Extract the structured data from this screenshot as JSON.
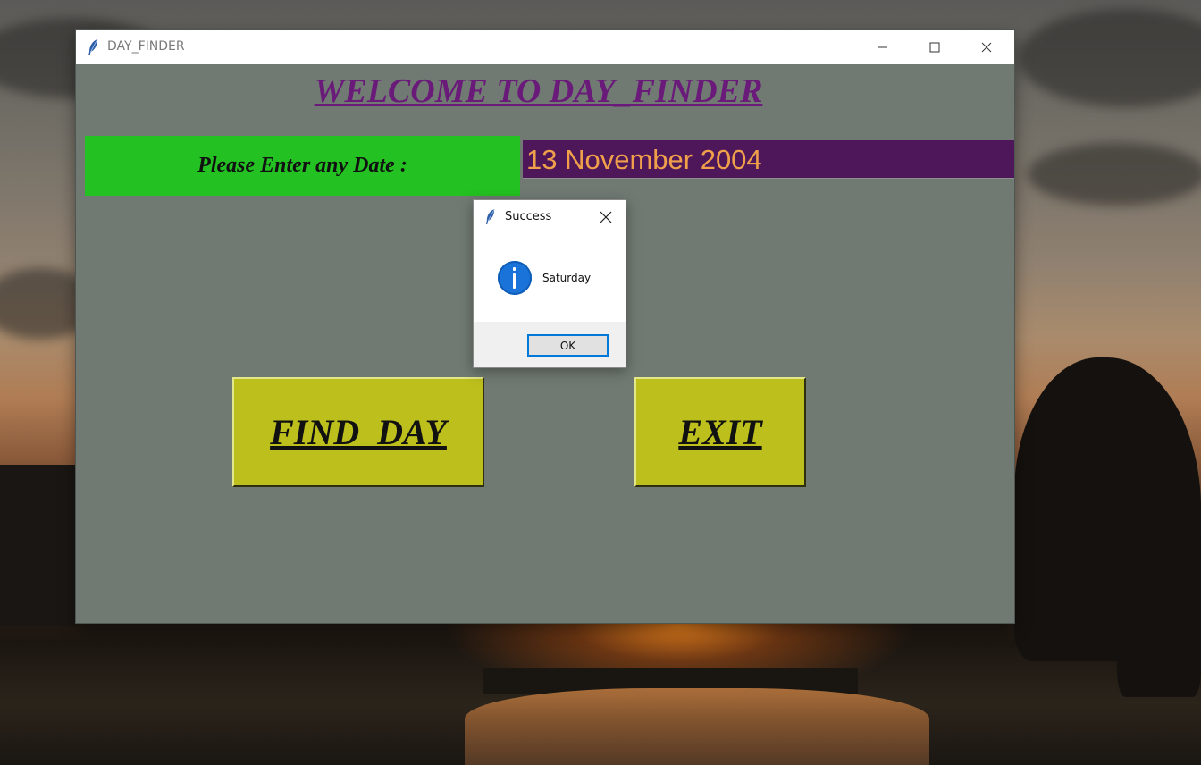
{
  "window": {
    "title": "DAY_FINDER",
    "icon": "feather-icon",
    "controls": [
      "minimize-icon",
      "maximize-icon",
      "close-icon"
    ],
    "background_color": "#707a72"
  },
  "main": {
    "heading": "WELCOME TO DAY_FINDER",
    "prompt_label": "Please Enter any Date :",
    "date_input_value": "13 November 2004",
    "find_button_label": "FIND_DAY",
    "exit_button_label": "EXIT"
  },
  "dialog": {
    "title": "Success",
    "icon": "info-icon",
    "message": "Saturday",
    "ok_label": "OK"
  },
  "colors": {
    "heading": "#6a1b7a",
    "prompt_bg": "#23c121",
    "input_bg": "#4e175a",
    "input_text": "#f0a04a",
    "button_bg": "#bcbf1c",
    "dialog_accent": "#0078d7"
  }
}
